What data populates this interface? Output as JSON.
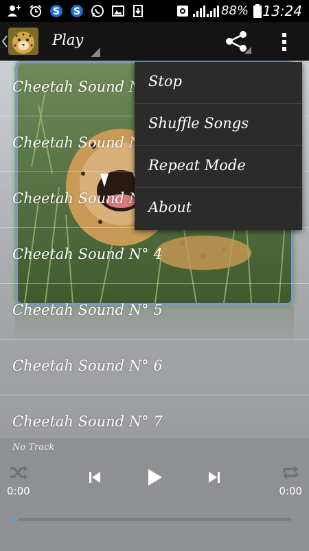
{
  "status_bar": {
    "battery_percent": "88%",
    "time": "13:24"
  },
  "action_bar": {
    "title": "Play"
  },
  "tracks": [
    {
      "label": "Cheetah Sound N° 1"
    },
    {
      "label": "Cheetah Sound N° 2"
    },
    {
      "label": "Cheetah Sound N° 3"
    },
    {
      "label": "Cheetah Sound N° 4"
    },
    {
      "label": "Cheetah Sound N° 5"
    },
    {
      "label": "Cheetah Sound N° 6"
    },
    {
      "label": "Cheetah Sound N° 7"
    }
  ],
  "menu": {
    "items": [
      {
        "label": "Stop"
      },
      {
        "label": "Shuffle Songs"
      },
      {
        "label": "Repeat Mode"
      },
      {
        "label": "About"
      }
    ]
  },
  "player": {
    "now_playing": "No Track",
    "elapsed": "0:00",
    "duration": "0:00",
    "progress": 0.02
  },
  "colors": {
    "accent": "#33b5e5",
    "menu_bg": "#2b2b2b",
    "action_bar_bg": "#141414"
  }
}
